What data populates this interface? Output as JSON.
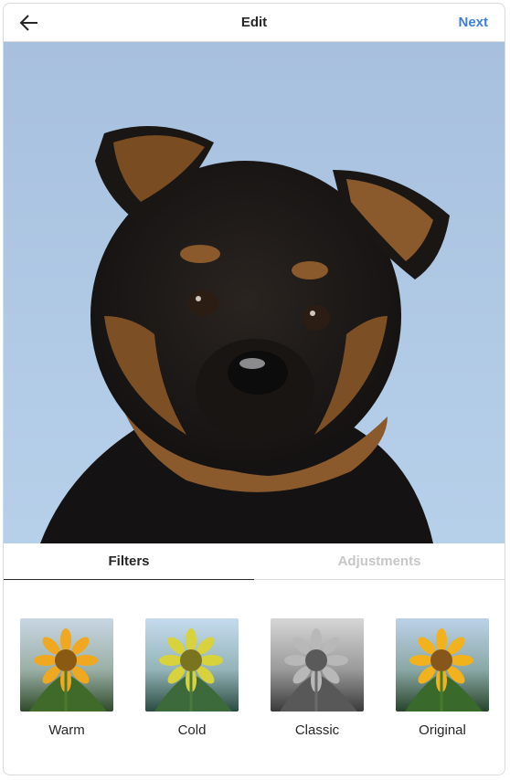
{
  "header": {
    "title": "Edit",
    "next_label": "Next"
  },
  "icons": {
    "back": "arrow-left-icon"
  },
  "photo": {
    "subject": "puppy photo"
  },
  "tabs": [
    {
      "label": "Filters",
      "active": true
    },
    {
      "label": "Adjustments",
      "active": false
    }
  ],
  "filters": [
    {
      "label": "Warm"
    },
    {
      "label": "Cold"
    },
    {
      "label": "Classic"
    },
    {
      "label": "Original"
    }
  ],
  "colors": {
    "accent": "#3f7fdc",
    "sky": "#a9c4e0",
    "border": "#dbdbdb"
  }
}
